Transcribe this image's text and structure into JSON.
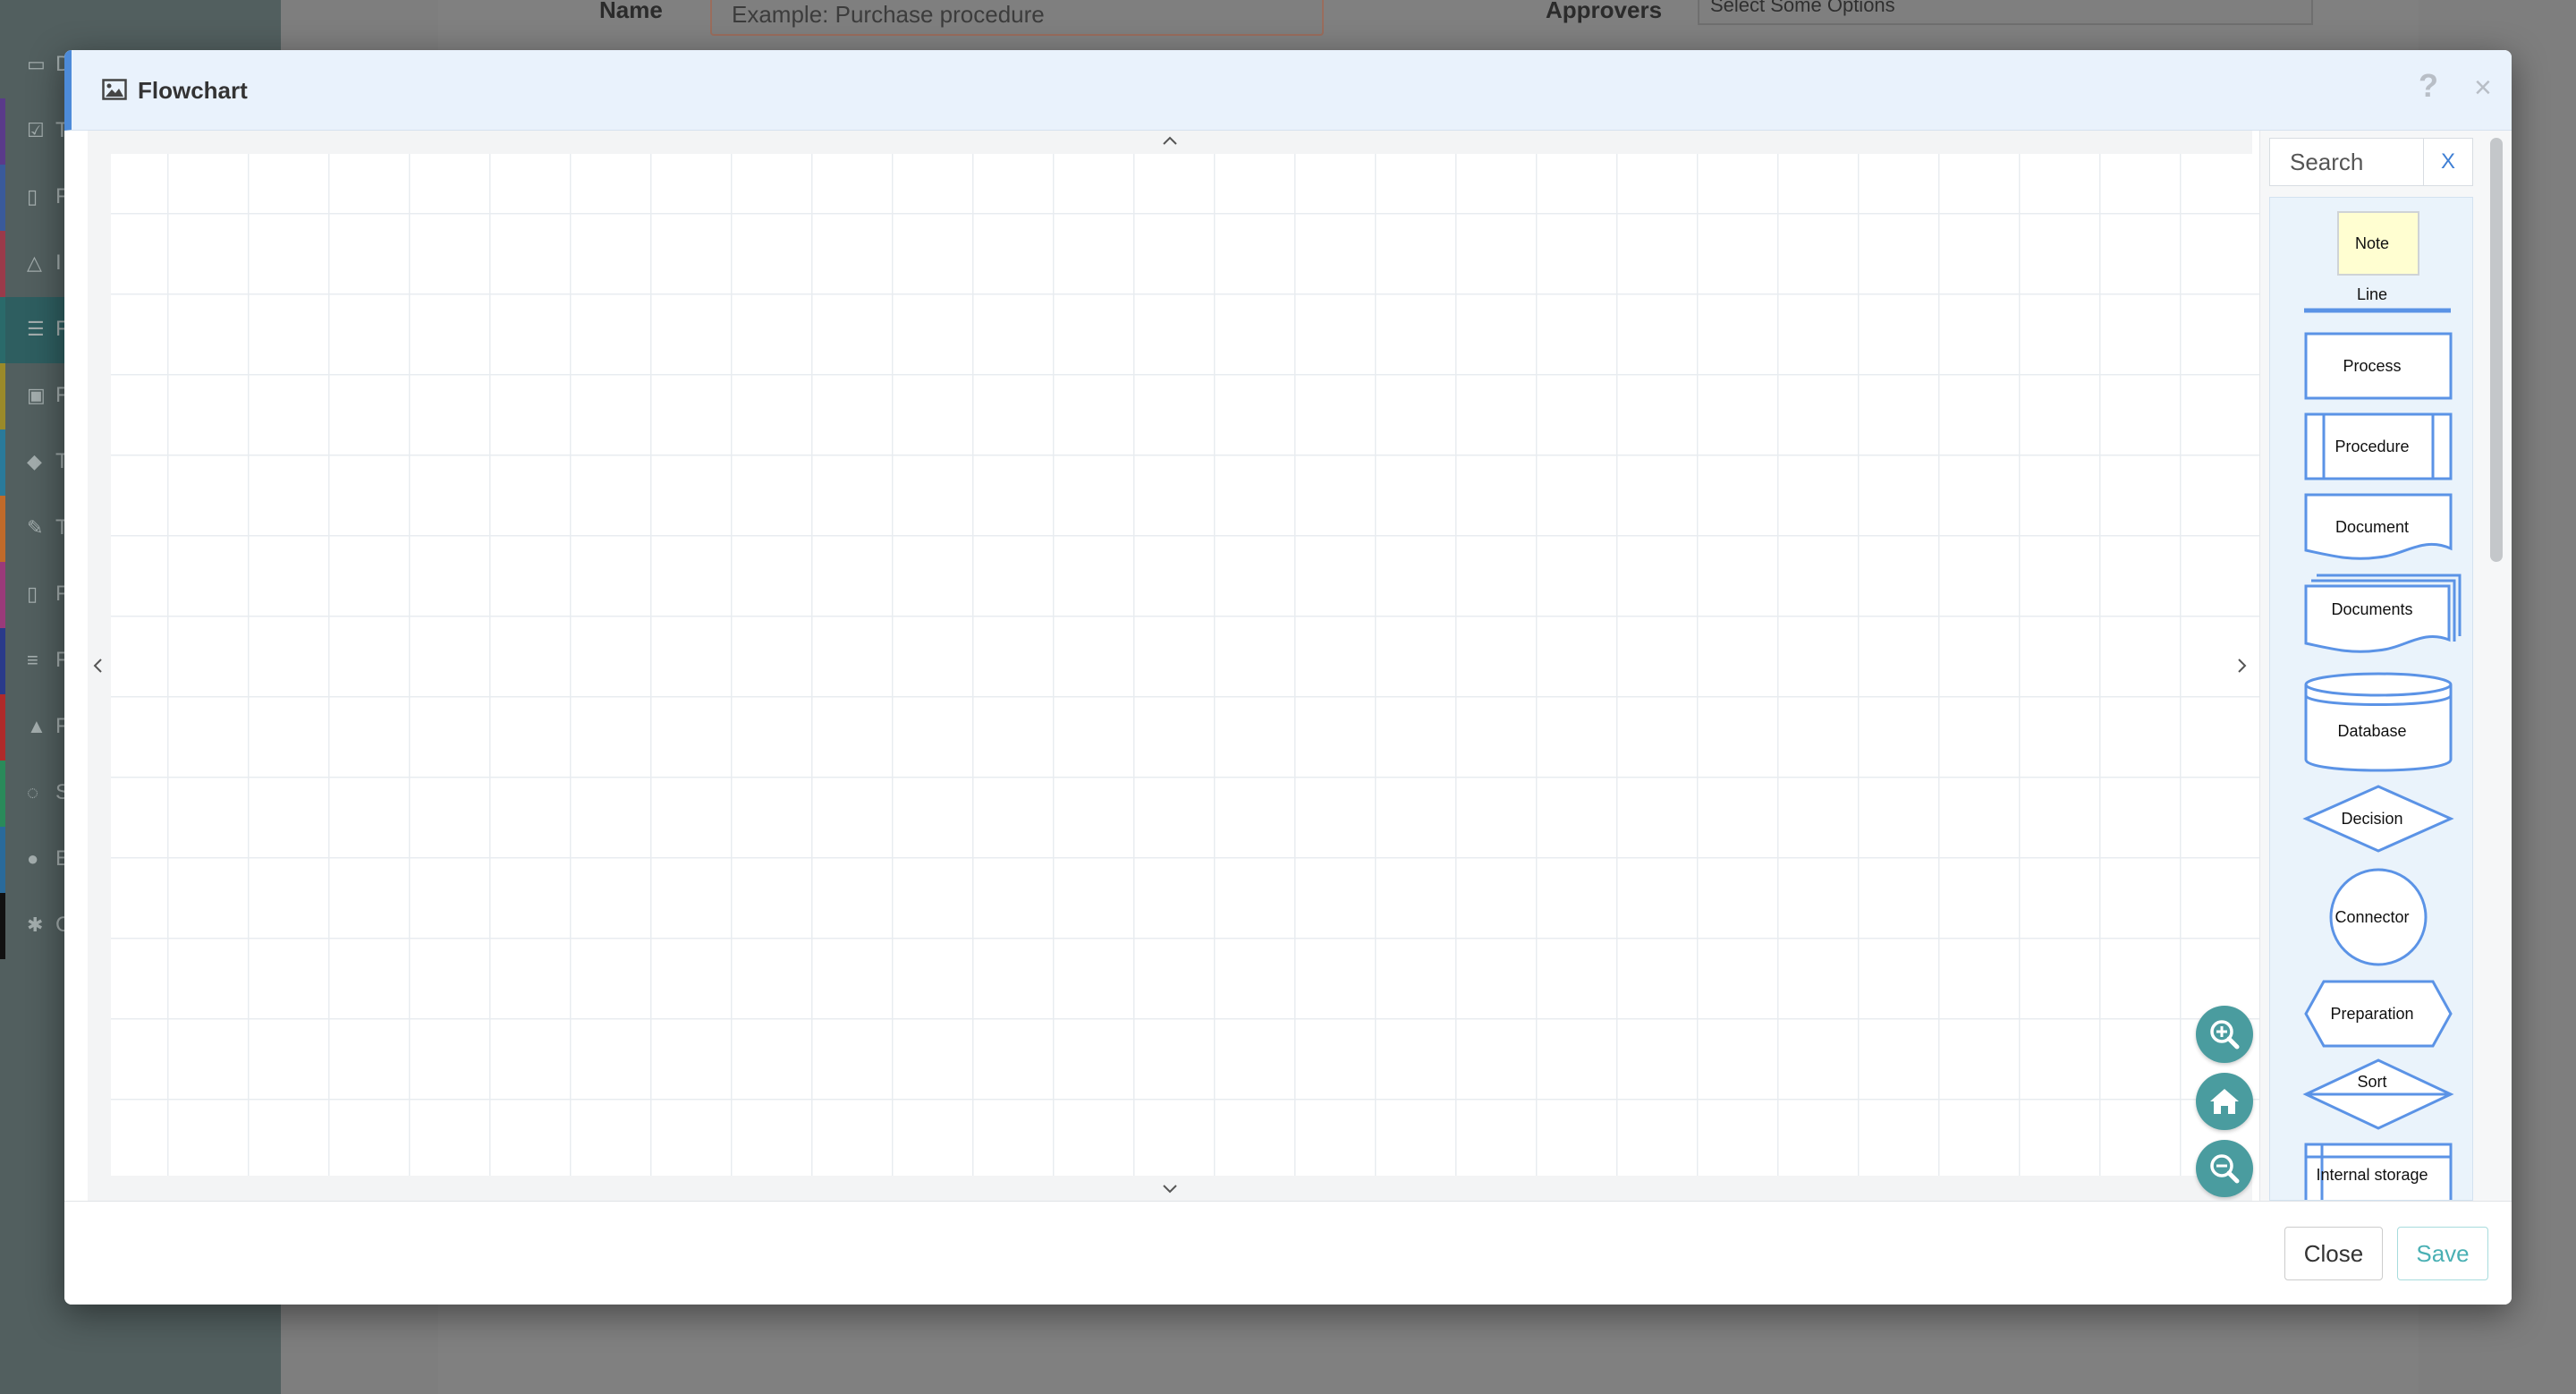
{
  "background": {
    "form": {
      "name_label": "Name",
      "name_placeholder": "Example: Purchase procedure",
      "approvers_label": "Approvers",
      "approvers_value": "Select Some Options"
    },
    "sidebar": {
      "items": [
        {
          "icon": "monitor-icon",
          "label": "D",
          "color": "#525f5f"
        },
        {
          "icon": "checkbox-icon",
          "label": "T",
          "color": "#5a3a8a"
        },
        {
          "icon": "document-icon",
          "label": "F",
          "color": "#3a5a9a"
        },
        {
          "icon": "bell-icon",
          "label": "I",
          "color": "#9a3a4a"
        },
        {
          "icon": "list-icon",
          "label": "F",
          "color": "#2a6a6a"
        },
        {
          "icon": "calendar-icon",
          "label": "F",
          "color": "#9a8a2a"
        },
        {
          "icon": "graduation-icon",
          "label": "T",
          "color": "#2a7a9a"
        },
        {
          "icon": "wrench-icon",
          "label": "T",
          "color": "#c06a2a"
        },
        {
          "icon": "file-icon",
          "label": "F",
          "color": "#9a3a7a"
        },
        {
          "icon": "bars-icon",
          "label": "F",
          "color": "#2a3a8a"
        },
        {
          "icon": "warning-icon",
          "label": "F",
          "color": "#b02a2a"
        },
        {
          "icon": "chat-icon",
          "label": "S",
          "color": "#2a8a5a"
        },
        {
          "icon": "users-icon",
          "label": "E",
          "color": "#2a6a9a"
        },
        {
          "icon": "gear-icon",
          "label": "C",
          "color": "#111111"
        }
      ]
    }
  },
  "modal": {
    "title": "Flowchart",
    "help": "?",
    "close_icon": "×",
    "search_placeholder": "Search",
    "search_clear": "X",
    "shapes": [
      "Note",
      "Line",
      "Process",
      "Procedure",
      "Document",
      "Documents",
      "Database",
      "Decision",
      "Connector",
      "Preparation",
      "Sort",
      "Internal storage"
    ],
    "zoom_controls": [
      "zoom-in-icon",
      "home-icon",
      "zoom-out-icon"
    ],
    "footer": {
      "close_label": "Close",
      "save_label": "Save"
    },
    "colors": {
      "accent": "#4d8bd9",
      "teal": "#4a9c9f",
      "shape_stroke": "#5b93e6",
      "note_fill": "#fffed1"
    }
  }
}
